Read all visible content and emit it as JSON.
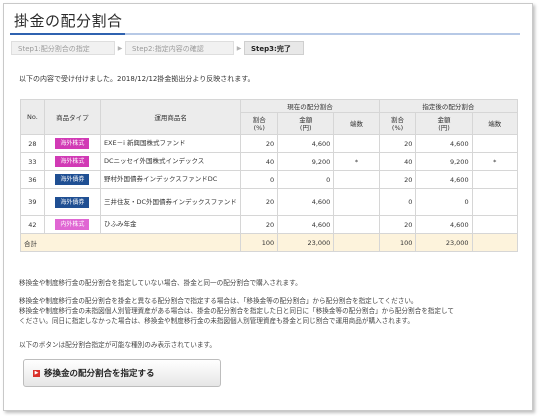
{
  "page": {
    "title": "掛金の配分割合"
  },
  "steps": [
    {
      "label": "Step1:配分割合の指定"
    },
    {
      "label": "Step2:指定内容の確認"
    },
    {
      "label": "Step3:完了"
    }
  ],
  "notice": "以下の内容で受け付けました。2018/12/12掛金拠出分より反映されます。",
  "table": {
    "headers": {
      "no": "No.",
      "type": "商品タイプ",
      "product": "運用商品名",
      "current_group": "現在の配分割合",
      "designated_group": "指定後の配分割合",
      "ratio": "割合",
      "ratio_unit": "(%)",
      "amount": "金額",
      "amount_unit": "(円)",
      "fraction": "端数"
    },
    "rows": [
      {
        "no": "28",
        "type": "海外株式",
        "type_color": "#d13ab5",
        "name": "EXE－i 新興国株式ファンド",
        "cur_ratio": "20",
        "cur_amount": "4,600",
        "cur_frac": "",
        "new_ratio": "20",
        "new_amount": "4,600",
        "new_frac": ""
      },
      {
        "no": "33",
        "type": "海外株式",
        "type_color": "#d13ab5",
        "name": "DCニッセイ外国株式インデックス",
        "cur_ratio": "40",
        "cur_amount": "9,200",
        "cur_frac": "*",
        "new_ratio": "40",
        "new_amount": "9,200",
        "new_frac": "*"
      },
      {
        "no": "36",
        "type": "海外債券",
        "type_color": "#1f4f93",
        "name": "野村外国債券インデックスファンドDC",
        "cur_ratio": "0",
        "cur_amount": "0",
        "cur_frac": "",
        "new_ratio": "20",
        "new_amount": "4,600",
        "new_frac": ""
      },
      {
        "no": "39",
        "type": "海外債券",
        "type_color": "#1f4f93",
        "name": "三井住友・DC外国債券インデックスファンド",
        "cur_ratio": "20",
        "cur_amount": "4,600",
        "cur_frac": "",
        "new_ratio": "0",
        "new_amount": "0",
        "new_frac": ""
      },
      {
        "no": "42",
        "type": "内外株式",
        "type_color": "#e066d3",
        "name": "ひふみ年金",
        "cur_ratio": "20",
        "cur_amount": "4,600",
        "cur_frac": "",
        "new_ratio": "20",
        "new_amount": "4,600",
        "new_frac": ""
      }
    ],
    "total": {
      "label": "合計",
      "cur_ratio": "100",
      "cur_amount": "23,000",
      "new_ratio": "100",
      "new_amount": "23,000"
    }
  },
  "paragraphs": {
    "p1": "移換金や制度移行金の配分割合を指定していない場合、掛金と同一の配分割合で購入されます。",
    "p2a": "移換金や制度移行金の配分割合を掛金と異なる配分割合で指定する場合は、「移換金等の配分割合」から配分割合を指定してください。",
    "p2b": "移換金や制度移行金の未指図個人別管理資産がある場合は、掛金の配分割合を指定した日と同日に「移換金等の配分割合」から配分割合を指定して",
    "p2c": "ください。同日に指定しなかった場合は、移換金や制度移行金の未指図個人別管理資産も掛金と同じ割合で運用商品が購入されます。",
    "p3": "以下のボタンは配分割合指定が可能な種別のみ表示されています。"
  },
  "button": {
    "label": "移換金の配分割合を指定する",
    "icon": "arrow-right-icon"
  }
}
